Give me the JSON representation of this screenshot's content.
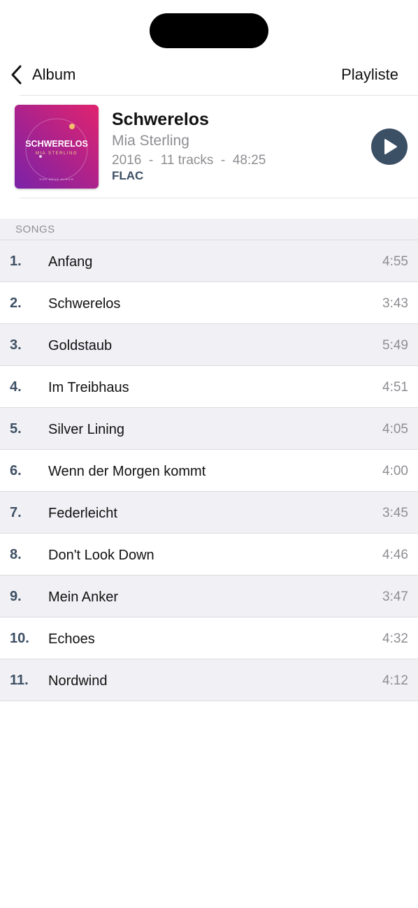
{
  "nav": {
    "back_label": "Album",
    "right_label": "Playliste"
  },
  "album": {
    "title": "Schwerelos",
    "artist": "Mia Sterling",
    "meta": "2016  -  11 tracks  -  48:25",
    "format": "FLAC",
    "cover": {
      "title": "SCHWERELOS",
      "artist": "MIA STERLING",
      "tagline": "DAS NEUE ALBUM",
      "colors": [
        "#e0236f",
        "#7a22a8"
      ]
    }
  },
  "section": {
    "label": "SONGS"
  },
  "colors": {
    "accent": "#3b4f65",
    "row_alt": "#f1f1f5",
    "secondary_text": "#8e8e93"
  },
  "songs": [
    {
      "num": "1.",
      "title": "Anfang",
      "duration": "4:55"
    },
    {
      "num": "2.",
      "title": "Schwerelos",
      "duration": "3:43"
    },
    {
      "num": "3.",
      "title": "Goldstaub",
      "duration": "5:49"
    },
    {
      "num": "4.",
      "title": "Im Treibhaus",
      "duration": "4:51"
    },
    {
      "num": "5.",
      "title": "Silver Lining",
      "duration": "4:05"
    },
    {
      "num": "6.",
      "title": "Wenn der Morgen kommt",
      "duration": "4:00"
    },
    {
      "num": "7.",
      "title": "Federleicht",
      "duration": "3:45"
    },
    {
      "num": "8.",
      "title": "Don't Look Down",
      "duration": "4:46"
    },
    {
      "num": "9.",
      "title": "Mein Anker",
      "duration": "3:47"
    },
    {
      "num": "10.",
      "title": "Echoes",
      "duration": "4:32"
    },
    {
      "num": "11.",
      "title": "Nordwind",
      "duration": "4:12"
    }
  ]
}
